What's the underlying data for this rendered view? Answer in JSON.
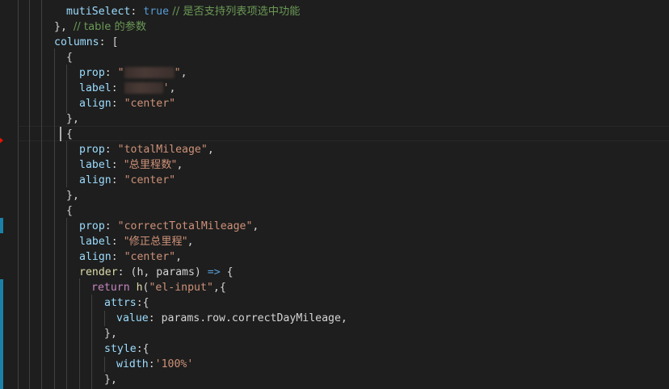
{
  "editor": {
    "colors": {
      "background": "#1e1e1e",
      "property": "#9cdcfe",
      "string": "#ce9178",
      "keyword": "#569cd6",
      "function": "#dcdcaa",
      "comment": "#6a9955",
      "git_marker": "#1b81a8",
      "breakpoint": "#e51400"
    },
    "lines": [
      {
        "t": [
          [
            "k",
            "mutiSelect"
          ],
          [
            "p",
            ": "
          ],
          [
            "w",
            "true"
          ],
          [
            "c",
            " // 是否支持列表项选中功能"
          ]
        ]
      },
      {
        "t": [
          [
            "p",
            "}, "
          ],
          [
            "c",
            "// table 的参数"
          ]
        ]
      },
      {
        "t": [
          [
            "k",
            "columns"
          ],
          [
            "p",
            ": ["
          ]
        ]
      },
      {
        "t": [
          [
            "p",
            "{"
          ]
        ]
      },
      {
        "t": [
          [
            "k",
            "prop"
          ],
          [
            "p",
            ": "
          ],
          [
            "s",
            "\""
          ],
          [
            "b",
            ""
          ],
          [
            "s",
            "\""
          ],
          [
            "p",
            ","
          ]
        ]
      },
      {
        "t": [
          [
            "k",
            "label"
          ],
          [
            "p",
            ": "
          ],
          [
            "b",
            ""
          ],
          [
            "s",
            "'"
          ],
          [
            "p",
            ","
          ]
        ]
      },
      {
        "t": [
          [
            "k",
            "align"
          ],
          [
            "p",
            ": "
          ],
          [
            "s",
            "\"center\""
          ]
        ]
      },
      {
        "t": [
          [
            "p",
            "},"
          ]
        ]
      },
      {
        "t": [
          [
            "p",
            "{"
          ]
        ]
      },
      {
        "t": [
          [
            "k",
            "prop"
          ],
          [
            "p",
            ": "
          ],
          [
            "s",
            "\"totalMileage\""
          ],
          [
            "p",
            ","
          ]
        ]
      },
      {
        "t": [
          [
            "k",
            "label"
          ],
          [
            "p",
            ": "
          ],
          [
            "s",
            "\"总里程数\""
          ],
          [
            "p",
            ","
          ]
        ]
      },
      {
        "t": [
          [
            "k",
            "align"
          ],
          [
            "p",
            ": "
          ],
          [
            "s",
            "\"center\""
          ]
        ]
      },
      {
        "t": [
          [
            "p",
            "},"
          ]
        ]
      },
      {
        "t": [
          [
            "p",
            "{"
          ]
        ]
      },
      {
        "t": [
          [
            "k",
            "prop"
          ],
          [
            "p",
            ": "
          ],
          [
            "s",
            "\"correctTotalMileage\""
          ],
          [
            "p",
            ","
          ]
        ]
      },
      {
        "t": [
          [
            "k",
            "label"
          ],
          [
            "p",
            ": "
          ],
          [
            "s",
            "\"修正总里程\""
          ],
          [
            "p",
            ","
          ]
        ]
      },
      {
        "t": [
          [
            "k",
            "align"
          ],
          [
            "p",
            ": "
          ],
          [
            "s",
            "\"center\""
          ],
          [
            "p",
            ","
          ]
        ]
      },
      {
        "t": [
          [
            "f",
            "render"
          ],
          [
            "p",
            ": (h, params) "
          ],
          [
            "w",
            "=>"
          ],
          [
            "p",
            " {"
          ]
        ]
      },
      {
        "t": [
          [
            "x",
            "return "
          ],
          [
            "f",
            "h"
          ],
          [
            "p",
            "("
          ],
          [
            "s",
            "\"el-input\""
          ],
          [
            "p",
            ",{"
          ]
        ]
      },
      {
        "t": [
          [
            "k",
            "attrs"
          ],
          [
            "p",
            ":{"
          ]
        ]
      },
      {
        "t": [
          [
            "k",
            "value"
          ],
          [
            "p",
            ": params.row.correctDayMileage,"
          ]
        ]
      },
      {
        "t": [
          [
            "p",
            "},"
          ]
        ]
      },
      {
        "t": [
          [
            "k",
            "style"
          ],
          [
            "p",
            ":{"
          ]
        ]
      },
      {
        "t": [
          [
            "k",
            "width"
          ],
          [
            "p",
            ":"
          ],
          [
            "s",
            "'100%'"
          ]
        ]
      },
      {
        "t": [
          [
            "p",
            "},"
          ]
        ]
      }
    ]
  }
}
